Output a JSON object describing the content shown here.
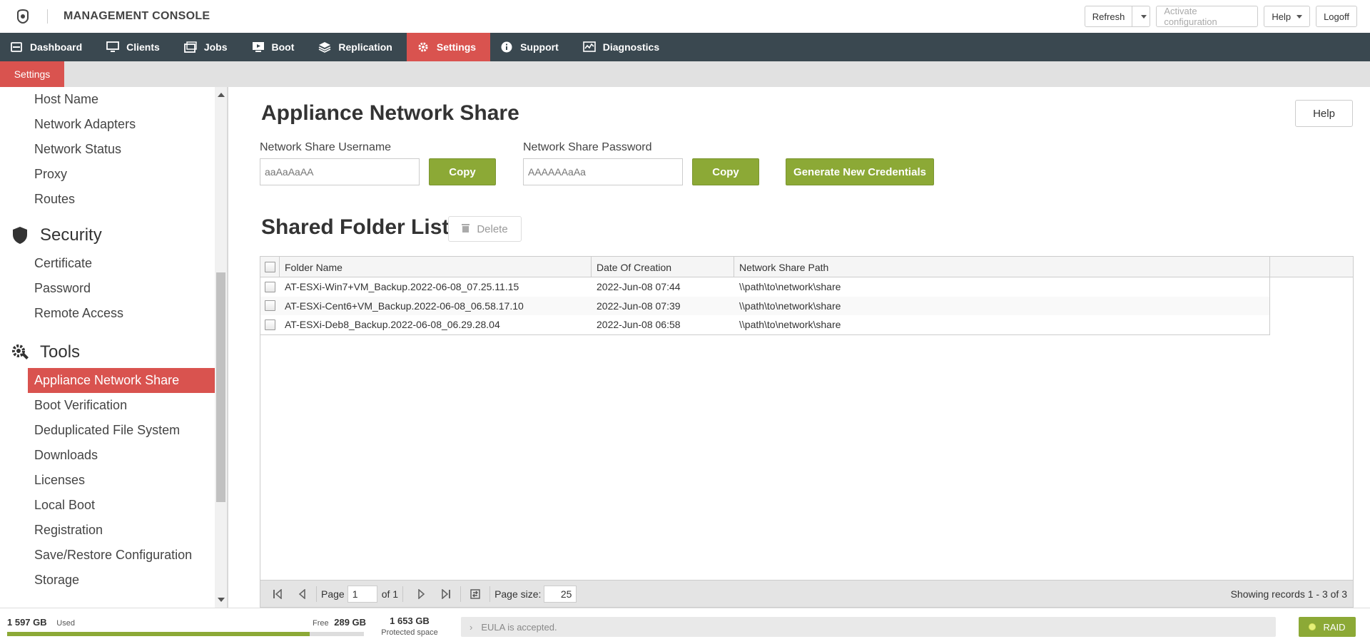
{
  "header": {
    "title": "MANAGEMENT CONSOLE",
    "refresh_label": "Refresh",
    "activate_label": "Activate configuration",
    "help_label": "Help",
    "logoff_label": "Logoff"
  },
  "nav": {
    "items": [
      {
        "label": "Dashboard",
        "icon": "dashboard-icon"
      },
      {
        "label": "Clients",
        "icon": "monitor-icon"
      },
      {
        "label": "Jobs",
        "icon": "jobs-icon"
      },
      {
        "label": "Boot",
        "icon": "boot-icon"
      },
      {
        "label": "Replication",
        "icon": "replication-icon"
      },
      {
        "label": "Settings",
        "icon": "gear-icon"
      },
      {
        "label": "Support",
        "icon": "info-icon"
      },
      {
        "label": "Diagnostics",
        "icon": "diagnostics-icon"
      }
    ],
    "active": "Settings"
  },
  "subtab": {
    "label": "Settings"
  },
  "sidebar": {
    "network_items": [
      "Host Name",
      "Network Adapters",
      "Network Status",
      "Proxy",
      "Routes"
    ],
    "security": {
      "title": "Security",
      "icon": "shield-icon",
      "items": [
        "Certificate",
        "Password",
        "Remote Access"
      ]
    },
    "tools": {
      "title": "Tools",
      "icon": "tools-gear-icon",
      "items": [
        "Appliance Network Share",
        "Boot Verification",
        "Deduplicated File System",
        "Downloads",
        "Licenses",
        "Local Boot",
        "Registration",
        "Save/Restore Configuration",
        "Storage"
      ],
      "active": "Appliance Network Share"
    }
  },
  "main": {
    "title": "Appliance Network Share",
    "help_label": "Help",
    "username_label": "Network Share Username",
    "username_placeholder": "aaAaAaAA",
    "password_label": "Network Share Password",
    "password_placeholder": "AAAAAAaAa",
    "copy_label": "Copy",
    "generate_label": "Generate New Credentials",
    "list_title": "Shared Folder List",
    "delete_label": "Delete",
    "columns": [
      "Folder Name",
      "Date Of Creation",
      "Network Share Path"
    ],
    "rows": [
      {
        "name": "AT-ESXi-Win7+VM_Backup.2022-06-08_07.25.11.15",
        "date": "2022-Jun-08 07:44",
        "path": "\\\\path\\to\\network\\share"
      },
      {
        "name": "AT-ESXi-Cent6+VM_Backup.2022-06-08_06.58.17.10",
        "date": "2022-Jun-08 07:39",
        "path": "\\\\path\\to\\network\\share"
      },
      {
        "name": "AT-ESXi-Deb8_Backup.2022-06-08_06.29.28.04",
        "date": "2022-Jun-08 06:58",
        "path": "\\\\path\\to\\network\\share"
      }
    ],
    "pager": {
      "page_label": "Page",
      "page_value": "1",
      "of_label": "of 1",
      "page_size_label": "Page size:",
      "page_size_value": "25",
      "records": "Showing records 1 - 3 of 3"
    }
  },
  "status": {
    "used_value": "1 597 GB",
    "used_label": "Used",
    "free_label": "Free",
    "free_value": "289 GB",
    "used_fraction": 0.847,
    "protected_value": "1 653 GB",
    "protected_label": "Protected space",
    "eula": "EULA is accepted.",
    "raid": "RAID"
  },
  "colors": {
    "accent_red": "#d9534f",
    "accent_green": "#8ca936",
    "nav_bg": "#3a4850"
  }
}
